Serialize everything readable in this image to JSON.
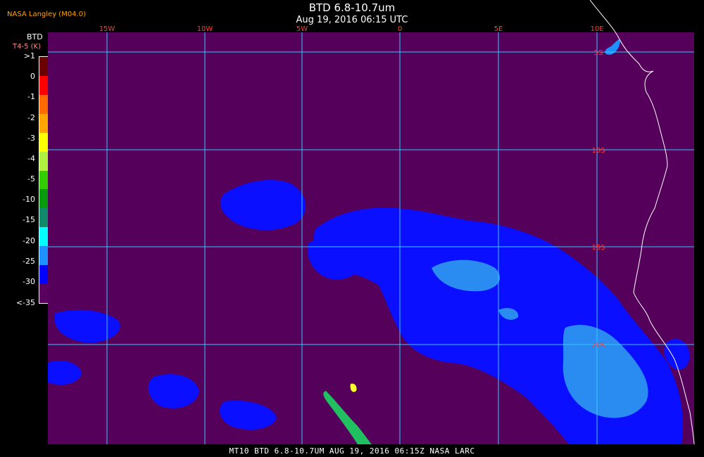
{
  "header": {
    "source": "NASA Langley (M04.0)",
    "title": "BTD 6.8-10.7um",
    "subtitle": "Aug 19, 2016 06:15 UTC"
  },
  "legend": {
    "title": "BTD",
    "units": "T4-5 (K)",
    "labels": [
      ">1",
      "0",
      "-1",
      "-2",
      "-3",
      "-4",
      "-5",
      "-10",
      "-15",
      "-20",
      "-25",
      "-30",
      "<-35"
    ],
    "colors": [
      "#6b0000",
      "#ff0000",
      "#ff6a00",
      "#ffa500",
      "#ffff00",
      "#b0f040",
      "#33cc00",
      "#0a9a10",
      "#108a6a",
      "#00ffff",
      "#1e90ff",
      "#0000ff",
      "#5a0060"
    ]
  },
  "map": {
    "background_color": "#55005a",
    "grid_color": "#37c8ff",
    "coast_color": "#ffffff",
    "lon_labels": [
      "15W",
      "10W",
      "5W",
      "0",
      "5E",
      "10E"
    ],
    "lat_labels": [
      "5S",
      "10S",
      "15S",
      "20S"
    ]
  },
  "footer": {
    "text": "MT10  BTD 6.8-10.7UM   AUG 19, 2016 06:15Z   NASA LARC"
  }
}
